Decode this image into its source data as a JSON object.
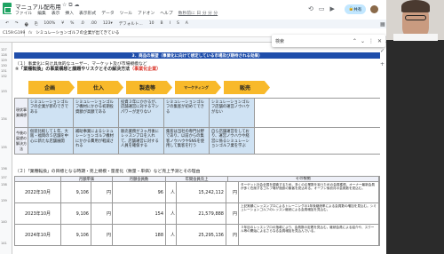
{
  "app": {
    "doc_title": "マニュアル配布用",
    "title_icons": "☆ ⧉ ☁",
    "menus": [
      "ファイル",
      "編集",
      "表示",
      "挿入",
      "表示形式",
      "データ",
      "ツール",
      "アドオン",
      "ヘルプ"
    ],
    "last_edit": "数秒前に 日 分 分 分",
    "share_label": "共有"
  },
  "toolbar": {
    "items": [
      "↶",
      "↷",
      "🖶",
      "⎘",
      "100%",
      "¥",
      "%",
      ".0",
      ".00",
      "123▾",
      "デフォルト…",
      "10",
      "B",
      "I",
      "S",
      "A"
    ]
  },
  "formula": {
    "namebox": "C159:G199",
    "fx": "fx",
    "content": "シミュレーションゴルフの企業が出てきている"
  },
  "sheet": {
    "row_numbers": [
      "127",
      "128",
      "129",
      "130",
      "131",
      "132",
      "133",
      "134",
      "135",
      "136",
      "137",
      "138",
      "139",
      "140",
      "141",
      "142",
      "143",
      "144",
      "145",
      "146",
      "147",
      "148"
    ],
    "banner": "3．商品の展望（事業化に向けて想定している市場及び期待される効果）",
    "line1": "（１）事業化に向け具体的なユーザー、マーケット及び市場規模など",
    "line2": "①「業種転換」の事業構想と課題やリスクとその解決方法",
    "line2_red": "（事業化企業）",
    "arrows": [
      "企画",
      "仕入",
      "製造等",
      "マーケティング",
      "販売"
    ],
    "row_a_header": "現状事業構想",
    "row_a": [
      "シミュレーションゴルフの企業が新のできである",
      "シミュレーションゴルフ機材にかかる初期投資額が高額である",
      "投資３年にかかるが、店舗運営に対するマンパワーが足りない",
      "シミュレーションゴルフの集客が初めてできる",
      "シミュレーションゴルフ店舗の運営ノウハウがない"
    ],
    "row_b_header": "今後の展望の解決方法",
    "row_b": [
      "仮装比較して１年、大阪・福岡の５店舗を中心に新たな店舗展開",
      "補助事業によるシミュレーションゴルフ機材にかかる費用が軽減される",
      "販売業務が３ヶ月後にレッスンプロを入れて、店舗運営に対する人員を確保する",
      "集客は当社の専門分野であり、以前からの集客ノウハウやSNSを使用して集客を行う",
      "自ら店舗運営をしており、運営ノウハウや経営に係るシミュレーションゴルフ業を学ぶ"
    ],
    "sec2": "（２）「業種転換」の目標となる時期・売上規模・量産化（数量・単価）など売上予測とその理由",
    "t2_headers": [
      "",
      "月額単価",
      "月額会員数",
      "年間会員売上",
      "その根拠"
    ],
    "t2_rows": [
      {
        "date": "2022年10月",
        "price": "9,106",
        "unit": "円",
        "count": "96",
        "unit2": "人",
        "sales": "15,242,112",
        "unit3": "円",
        "basis": "ターゲット社会全国を調査するため、多くの企業数を狙うための会員獲得。オーナー最新会員が多く在席するゴルフ場が施設の集客を見込める。オープン後初月の会員数を見込む。"
      },
      {
        "date": "2023年10月",
        "price": "9,106",
        "unit": "円",
        "count": "154",
        "unit2": "人",
        "sales": "21,579,888",
        "unit3": "円",
        "basis": "上記実績にレッスンプロによるトレーニングの1年後継続率による会員数の増加を見込む。シミュレーションゴルフのレッスン継続による会員増加を見込む。"
      },
      {
        "date": "2024年10月",
        "price": "9,106",
        "unit": "円",
        "count": "188",
        "unit2": "人",
        "sales": "25,295,136",
        "unit3": "円",
        "basis": "３年目のレッスンプロの指導により、会員数の定着を見込む。継続会員による紹介や、スクール等の開始によるさらなる会員増加を見込んでいる。"
      }
    ]
  },
  "search": {
    "placeholder": "検索"
  },
  "colors": {
    "banner": "#1f4eab",
    "arrow": "#f8b92a",
    "cell": "#cfe2f3",
    "accent_red": "#d93025",
    "sheets_green": "#1ea362"
  }
}
